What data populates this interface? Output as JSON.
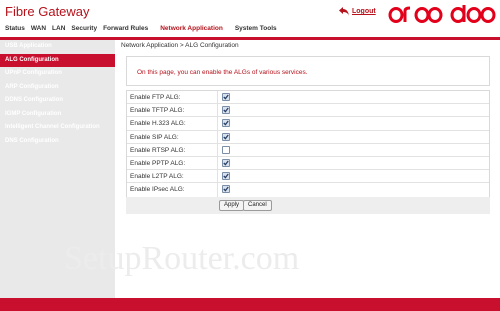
{
  "header": {
    "title": "Fibre Gateway",
    "logout_label": "Logout",
    "brand_logo": "ooredoo",
    "brand_color": "#c8102e"
  },
  "topnav": {
    "items": [
      "Status",
      "WAN",
      "LAN",
      "Security",
      "Forward Rules",
      "Network Application",
      "System Tools"
    ],
    "active": "Network Application"
  },
  "sidebar": {
    "items": [
      "USB Application",
      "ALG Configuration",
      "UPnP Configuration",
      "ARP Configuration",
      "DDNS Configuration",
      "IGMP Configuration",
      "Intelligent Channel Configuration",
      "DNS Configuration"
    ],
    "active": "ALG Configuration"
  },
  "main": {
    "breadcrumb": "Network Application > ALG Configuration",
    "description": "On this page, you can enable the ALGs of various services.",
    "algs": [
      {
        "label": "Enable FTP ALG:",
        "checked": true
      },
      {
        "label": "Enable TFTP ALG:",
        "checked": true
      },
      {
        "label": "Enable H.323 ALG:",
        "checked": true
      },
      {
        "label": "Enable SIP ALG:",
        "checked": true
      },
      {
        "label": "Enable RTSP ALG:",
        "checked": false
      },
      {
        "label": "Enable PPTP ALG:",
        "checked": true
      },
      {
        "label": "Enable L2TP ALG:",
        "checked": true
      },
      {
        "label": "Enable IPsec ALG:",
        "checked": true
      }
    ],
    "apply_label": "Apply",
    "cancel_label": "Cancel"
  },
  "watermark": "SetupRouter.com"
}
